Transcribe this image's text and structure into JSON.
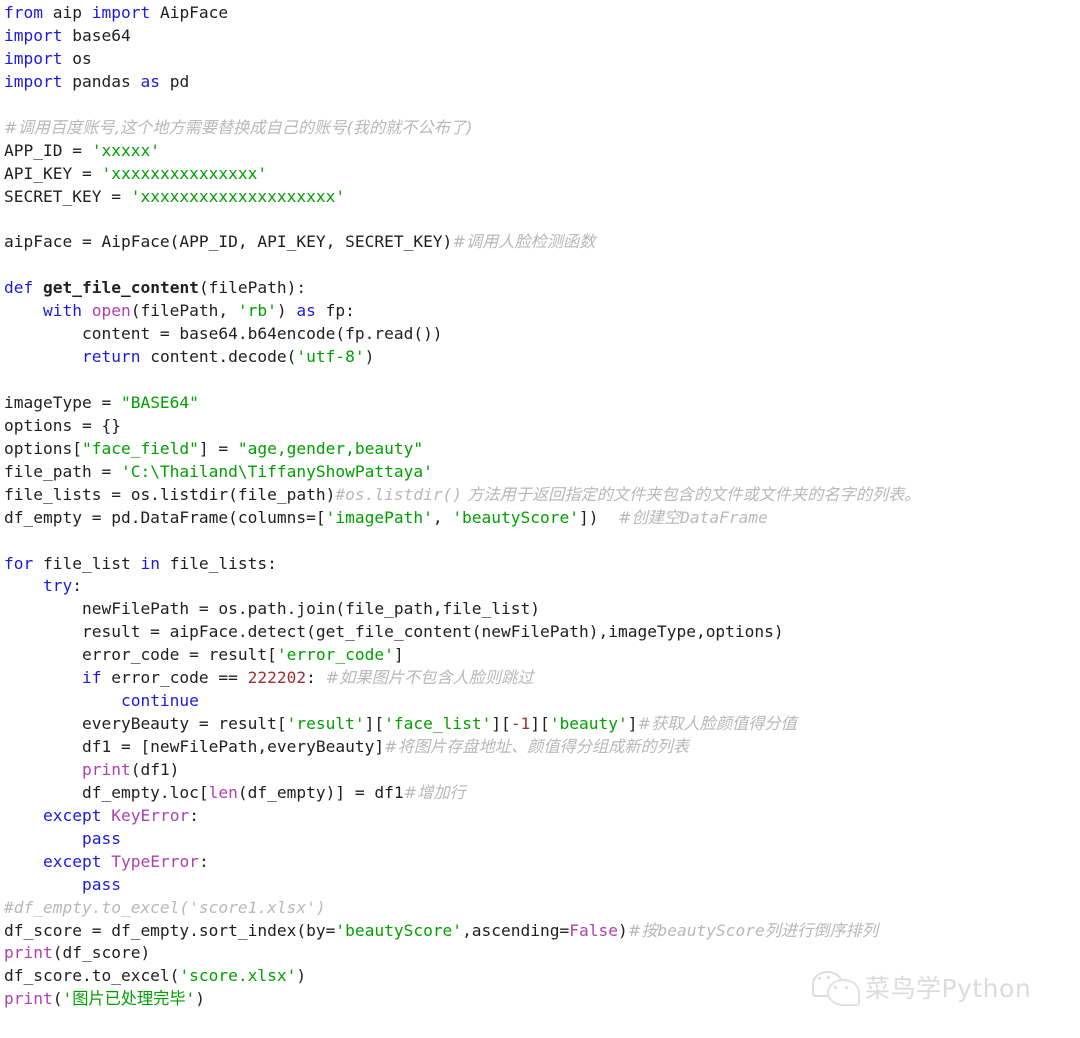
{
  "document": {
    "kind": "python-source-code-screenshot",
    "language": "Python",
    "colors": {
      "background": "#ffffff",
      "keyword": "#1a1ae6",
      "builtin": "#b040b0",
      "string": "#00a000",
      "number": "#a03030",
      "plain": "#202020",
      "comment": "#b8b8b8",
      "watermark": "#c6c6c6"
    }
  },
  "watermark": {
    "icon": "wechat-icon",
    "text": "菜鸟学Python"
  },
  "code_lines": [
    {
      "id": "l1",
      "indent": 0,
      "tokens": [
        {
          "t": "kw",
          "v": "from"
        },
        {
          "t": "pl",
          "v": " aip "
        },
        {
          "t": "kw",
          "v": "import"
        },
        {
          "t": "pl",
          "v": " AipFace"
        }
      ]
    },
    {
      "id": "l2",
      "indent": 0,
      "tokens": [
        {
          "t": "kw",
          "v": "import"
        },
        {
          "t": "pl",
          "v": " base64"
        }
      ]
    },
    {
      "id": "l3",
      "indent": 0,
      "tokens": [
        {
          "t": "kw",
          "v": "import"
        },
        {
          "t": "pl",
          "v": " os"
        }
      ]
    },
    {
      "id": "l4",
      "indent": 0,
      "tokens": [
        {
          "t": "kw",
          "v": "import"
        },
        {
          "t": "pl",
          "v": " pandas "
        },
        {
          "t": "kw",
          "v": "as"
        },
        {
          "t": "pl",
          "v": " pd"
        }
      ]
    },
    {
      "id": "l5",
      "indent": 0,
      "tokens": []
    },
    {
      "id": "l6",
      "indent": 0,
      "tokens": [
        {
          "t": "cmz",
          "v": "#调用百度账号,这个地方需要替换成自己的账号(我的就不公布了)"
        }
      ]
    },
    {
      "id": "l7",
      "indent": 0,
      "tokens": [
        {
          "t": "pl",
          "v": "APP_ID = "
        },
        {
          "t": "str",
          "v": "'xxxxx'"
        }
      ]
    },
    {
      "id": "l8",
      "indent": 0,
      "tokens": [
        {
          "t": "pl",
          "v": "API_KEY = "
        },
        {
          "t": "str",
          "v": "'xxxxxxxxxxxxxxx'"
        }
      ]
    },
    {
      "id": "l9",
      "indent": 0,
      "tokens": [
        {
          "t": "pl",
          "v": "SECRET_KEY = "
        },
        {
          "t": "str",
          "v": "'xxxxxxxxxxxxxxxxxxxx'"
        }
      ]
    },
    {
      "id": "l10",
      "indent": 0,
      "tokens": []
    },
    {
      "id": "l11",
      "indent": 0,
      "tokens": [
        {
          "t": "pl",
          "v": "aipFace = AipFace(APP_ID, API_KEY, SECRET_KEY)"
        },
        {
          "t": "cmz",
          "v": "#调用人脸检测函数"
        }
      ]
    },
    {
      "id": "l12",
      "indent": 0,
      "tokens": []
    },
    {
      "id": "l13",
      "indent": 0,
      "tokens": [
        {
          "t": "kw",
          "v": "def"
        },
        {
          "t": "pl",
          "v": " "
        },
        {
          "t": "fn",
          "v": "get_file_content"
        },
        {
          "t": "pl",
          "v": "(filePath):"
        }
      ]
    },
    {
      "id": "l14",
      "indent": 0,
      "tokens": [
        {
          "t": "pl",
          "v": "    "
        },
        {
          "t": "kw",
          "v": "with"
        },
        {
          "t": "pl",
          "v": " "
        },
        {
          "t": "bi",
          "v": "open"
        },
        {
          "t": "pl",
          "v": "(filePath, "
        },
        {
          "t": "str",
          "v": "'rb'"
        },
        {
          "t": "pl",
          "v": ") "
        },
        {
          "t": "kw",
          "v": "as"
        },
        {
          "t": "pl",
          "v": " fp:"
        }
      ]
    },
    {
      "id": "l15",
      "indent": 0,
      "tokens": [
        {
          "t": "pl",
          "v": "        content = base64.b64encode(fp.read())"
        }
      ]
    },
    {
      "id": "l16",
      "indent": 0,
      "tokens": [
        {
          "t": "pl",
          "v": "        "
        },
        {
          "t": "kw",
          "v": "return"
        },
        {
          "t": "pl",
          "v": " content.decode("
        },
        {
          "t": "str",
          "v": "'utf-8'"
        },
        {
          "t": "pl",
          "v": ")"
        }
      ]
    },
    {
      "id": "l17",
      "indent": 0,
      "tokens": []
    },
    {
      "id": "l18",
      "indent": 0,
      "tokens": [
        {
          "t": "pl",
          "v": "imageType = "
        },
        {
          "t": "str",
          "v": "\"BASE64\""
        }
      ]
    },
    {
      "id": "l19",
      "indent": 0,
      "tokens": [
        {
          "t": "pl",
          "v": "options = {}"
        }
      ]
    },
    {
      "id": "l20",
      "indent": 0,
      "tokens": [
        {
          "t": "pl",
          "v": "options["
        },
        {
          "t": "str",
          "v": "\"face_field\""
        },
        {
          "t": "pl",
          "v": "] = "
        },
        {
          "t": "str",
          "v": "\"age,gender,beauty\""
        }
      ]
    },
    {
      "id": "l21",
      "indent": 0,
      "tokens": [
        {
          "t": "pl",
          "v": "file_path = "
        },
        {
          "t": "str",
          "v": "'C:\\Thailand\\TiffanyShowPattaya'"
        }
      ]
    },
    {
      "id": "l22",
      "indent": 0,
      "tokens": [
        {
          "t": "pl",
          "v": "file_lists = os.listdir(file_path)"
        },
        {
          "t": "cm",
          "v": "#os.listdir()"
        },
        {
          "t": "cmz",
          "v": " 方法用于返回指定的文件夹包含的文件或文件夹的名字的列表。"
        }
      ]
    },
    {
      "id": "l23",
      "indent": 0,
      "tokens": [
        {
          "t": "pl",
          "v": "df_empty = pd.DataFrame(columns=["
        },
        {
          "t": "str",
          "v": "'imagePath'"
        },
        {
          "t": "pl",
          "v": ", "
        },
        {
          "t": "str",
          "v": "'beautyScore'"
        },
        {
          "t": "pl",
          "v": "])  "
        },
        {
          "t": "cmz",
          "v": "#创建空"
        },
        {
          "t": "cm",
          "v": "DataFrame"
        }
      ]
    },
    {
      "id": "l24",
      "indent": 0,
      "tokens": []
    },
    {
      "id": "l25",
      "indent": 0,
      "tokens": [
        {
          "t": "kw",
          "v": "for"
        },
        {
          "t": "pl",
          "v": " file_list "
        },
        {
          "t": "kw",
          "v": "in"
        },
        {
          "t": "pl",
          "v": " file_lists:"
        }
      ]
    },
    {
      "id": "l26",
      "indent": 0,
      "tokens": [
        {
          "t": "pl",
          "v": "    "
        },
        {
          "t": "kw",
          "v": "try"
        },
        {
          "t": "pl",
          "v": ":"
        }
      ]
    },
    {
      "id": "l27",
      "indent": 0,
      "tokens": [
        {
          "t": "pl",
          "v": "        newFilePath = os.path.join(file_path,file_list)"
        }
      ]
    },
    {
      "id": "l28",
      "indent": 0,
      "tokens": [
        {
          "t": "pl",
          "v": "        result = aipFace.detect(get_file_content(newFilePath),imageType,options)"
        }
      ]
    },
    {
      "id": "l29",
      "indent": 0,
      "tokens": [
        {
          "t": "pl",
          "v": "        error_code = result["
        },
        {
          "t": "str",
          "v": "'error_code'"
        },
        {
          "t": "pl",
          "v": "]"
        }
      ]
    },
    {
      "id": "l30",
      "indent": 0,
      "tokens": [
        {
          "t": "pl",
          "v": "        "
        },
        {
          "t": "kw",
          "v": "if"
        },
        {
          "t": "pl",
          "v": " error_code == "
        },
        {
          "t": "num",
          "v": "222202"
        },
        {
          "t": "pl",
          "v": ": "
        },
        {
          "t": "cmz",
          "v": "#如果图片不包含人脸则跳过"
        }
      ]
    },
    {
      "id": "l31",
      "indent": 0,
      "tokens": [
        {
          "t": "pl",
          "v": "            "
        },
        {
          "t": "kw",
          "v": "continue"
        }
      ]
    },
    {
      "id": "l32",
      "indent": 0,
      "tokens": [
        {
          "t": "pl",
          "v": "        everyBeauty = result["
        },
        {
          "t": "str",
          "v": "'result'"
        },
        {
          "t": "pl",
          "v": "]["
        },
        {
          "t": "str",
          "v": "'face_list'"
        },
        {
          "t": "pl",
          "v": "]["
        },
        {
          "t": "num",
          "v": "-1"
        },
        {
          "t": "pl",
          "v": "]["
        },
        {
          "t": "str",
          "v": "'beauty'"
        },
        {
          "t": "pl",
          "v": "]"
        },
        {
          "t": "cmz",
          "v": "#获取人脸颜值得分值"
        }
      ]
    },
    {
      "id": "l33",
      "indent": 0,
      "tokens": [
        {
          "t": "pl",
          "v": "        df1 = [newFilePath,everyBeauty]"
        },
        {
          "t": "cmz",
          "v": "#将图片存盘地址、颜值得分组成新的列表"
        }
      ]
    },
    {
      "id": "l34",
      "indent": 0,
      "tokens": [
        {
          "t": "pl",
          "v": "        "
        },
        {
          "t": "bi",
          "v": "print"
        },
        {
          "t": "pl",
          "v": "(df1)"
        }
      ]
    },
    {
      "id": "l35",
      "indent": 0,
      "tokens": [
        {
          "t": "pl",
          "v": "        df_empty.loc["
        },
        {
          "t": "bi",
          "v": "len"
        },
        {
          "t": "pl",
          "v": "(df_empty)] = df1"
        },
        {
          "t": "cmz",
          "v": "#增加行"
        }
      ]
    },
    {
      "id": "l36",
      "indent": 0,
      "tokens": [
        {
          "t": "pl",
          "v": "    "
        },
        {
          "t": "kw",
          "v": "except"
        },
        {
          "t": "pl",
          "v": " "
        },
        {
          "t": "bi",
          "v": "KeyError"
        },
        {
          "t": "pl",
          "v": ":"
        }
      ]
    },
    {
      "id": "l37",
      "indent": 0,
      "tokens": [
        {
          "t": "pl",
          "v": "        "
        },
        {
          "t": "kw",
          "v": "pass"
        }
      ]
    },
    {
      "id": "l38",
      "indent": 0,
      "tokens": [
        {
          "t": "pl",
          "v": "    "
        },
        {
          "t": "kw",
          "v": "except"
        },
        {
          "t": "pl",
          "v": " "
        },
        {
          "t": "bi",
          "v": "TypeError"
        },
        {
          "t": "pl",
          "v": ":"
        }
      ]
    },
    {
      "id": "l39",
      "indent": 0,
      "tokens": [
        {
          "t": "pl",
          "v": "        "
        },
        {
          "t": "kw",
          "v": "pass"
        }
      ]
    },
    {
      "id": "l40",
      "indent": 0,
      "tokens": [
        {
          "t": "cm",
          "v": "#df_empty.to_excel('score1.xlsx')"
        }
      ]
    },
    {
      "id": "l41",
      "indent": 0,
      "tokens": [
        {
          "t": "pl",
          "v": "df_score = df_empty.sort_index(by="
        },
        {
          "t": "str",
          "v": "'beautyScore'"
        },
        {
          "t": "pl",
          "v": ",ascending="
        },
        {
          "t": "bi",
          "v": "False"
        },
        {
          "t": "pl",
          "v": ")"
        },
        {
          "t": "cmz",
          "v": "#按"
        },
        {
          "t": "cm",
          "v": "beautyScore"
        },
        {
          "t": "cmz",
          "v": "列进行倒序排列"
        }
      ]
    },
    {
      "id": "l42",
      "indent": 0,
      "tokens": [
        {
          "t": "bi",
          "v": "print"
        },
        {
          "t": "pl",
          "v": "(df_score)"
        }
      ]
    },
    {
      "id": "l43",
      "indent": 0,
      "tokens": [
        {
          "t": "pl",
          "v": "df_score.to_excel("
        },
        {
          "t": "str",
          "v": "'score.xlsx'"
        },
        {
          "t": "pl",
          "v": ")"
        }
      ]
    },
    {
      "id": "l44",
      "indent": 0,
      "tokens": [
        {
          "t": "bi",
          "v": "print"
        },
        {
          "t": "pl",
          "v": "("
        },
        {
          "t": "str",
          "v": "'"
        },
        {
          "t": "str zh",
          "v": "图片已处理完毕"
        },
        {
          "t": "str",
          "v": "'"
        },
        {
          "t": "pl",
          "v": ")"
        }
      ]
    }
  ]
}
